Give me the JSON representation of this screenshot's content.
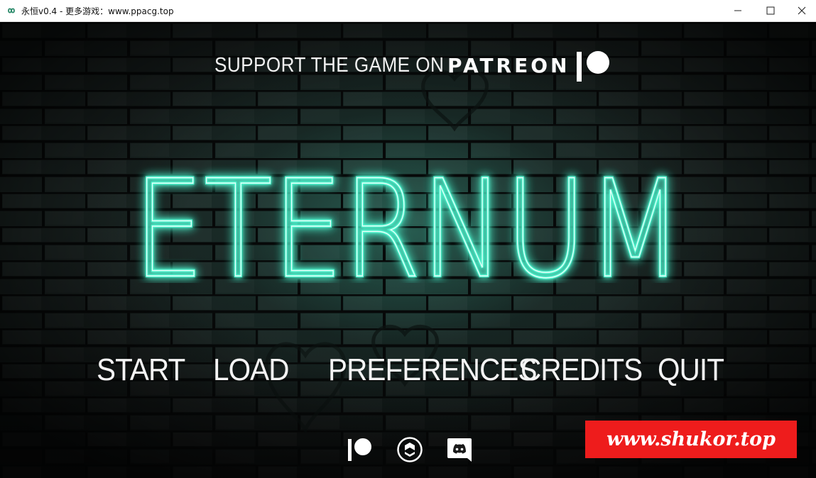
{
  "window": {
    "title": "永恒v0.4 - 更多游戏：www.ppacg.top",
    "icon": "infinity-icon",
    "controls": [
      "minimize-icon",
      "maximize-icon",
      "close-icon"
    ]
  },
  "banner": {
    "support_text": "SUPPORT THE GAME ON",
    "patreon_text": "PATREON",
    "logo": "patreon-icon"
  },
  "logo": {
    "title": "ETERNUM",
    "glow_color": "#4ff5cf"
  },
  "menu": {
    "items": [
      {
        "label": "START"
      },
      {
        "label": "LOAD"
      },
      {
        "label": "PREFERENCES"
      },
      {
        "label": "CREDITS"
      },
      {
        "label": "QUIT"
      }
    ]
  },
  "social": [
    {
      "icon": "patreon-icon"
    },
    {
      "icon": "subscribestar-icon"
    },
    {
      "icon": "discord-icon"
    }
  ],
  "watermark": {
    "text": "www.shukor.top",
    "color": "#ee1c1c"
  },
  "colors": {
    "neon": "#4ff5cf",
    "wall_tint": "#1c2624",
    "menu_text": "#f4f4f4"
  }
}
